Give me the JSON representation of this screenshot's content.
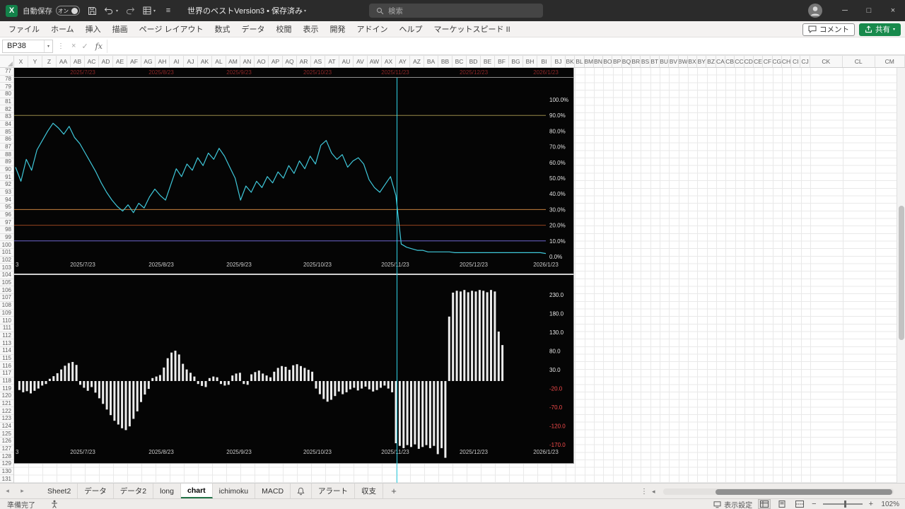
{
  "titlebar": {
    "autosave_label": "自動保存",
    "autosave_state": "オン",
    "document_title": "世界のベストVersion3 • 保存済み",
    "search_placeholder": "検索"
  },
  "menubar": {
    "items": [
      "ファイル",
      "ホーム",
      "挿入",
      "描画",
      "ページ レイアウト",
      "数式",
      "データ",
      "校閲",
      "表示",
      "開発",
      "アドイン",
      "ヘルプ",
      "マーケットスピード II"
    ],
    "comment_label": "コメント",
    "share_label": "共有"
  },
  "formula_bar": {
    "name_box_value": "BP38",
    "fx_label": "fx",
    "cancel_glyph": "×",
    "enter_glyph": "✓",
    "splitter_glyph": "⋮"
  },
  "grid": {
    "columns": [
      "X",
      "Y",
      "Z",
      "AA",
      "AB",
      "AC",
      "AD",
      "AE",
      "AF",
      "AG",
      "AH",
      "AI",
      "AJ",
      "AK",
      "AL",
      "AM",
      "AN",
      "AO",
      "AP",
      "AQ",
      "AR",
      "AS",
      "AT",
      "AU",
      "AV",
      "AW",
      "AX",
      "AY",
      "AZ",
      "BA",
      "BB",
      "BC",
      "BD",
      "BE",
      "BF",
      "BG",
      "BH",
      "BI",
      "BJ",
      "BK",
      "BL",
      "BM",
      "BN",
      "BO",
      "BP",
      "BQ",
      "BR",
      "BS",
      "BT",
      "BU",
      "BV",
      "BW",
      "BX",
      "BY",
      "BZ",
      "CA",
      "CB",
      "CC",
      "CD",
      "CE",
      "CF",
      "CG",
      "CH",
      "CI",
      "CJ",
      "CK",
      "CL",
      "CM"
    ],
    "row_start": 77,
    "row_count": 55
  },
  "chart_data": [
    {
      "type": "line",
      "name": "stochastic-oscillator",
      "line_color": "#3fc8da",
      "y_tick_labels": [
        "100.0%",
        "90.0%",
        "80.0%",
        "70.0%",
        "60.0%",
        "50.0%",
        "40.0%",
        "30.0%",
        "20.0%",
        "10.0%",
        "0.0%"
      ],
      "ref_lines": [
        {
          "value": 90,
          "color": "#968a49"
        },
        {
          "value": 30,
          "color": "#c57f3d"
        },
        {
          "value": 20,
          "color": "#96451f"
        },
        {
          "value": 10,
          "color": "#6f66cf"
        }
      ],
      "x_labels": [
        "2025/7/23",
        "2025/8/23",
        "2025/9/23",
        "2025/10/23",
        "2025/11/23",
        "2025/12/23",
        "2026/1/23"
      ],
      "edge_label": "3",
      "ylim": [
        0,
        110
      ],
      "values": [
        57,
        48,
        62,
        55,
        68,
        74,
        80,
        85,
        82,
        78,
        83,
        76,
        72,
        66,
        60,
        54,
        47,
        41,
        36,
        32,
        29,
        33,
        28,
        34,
        31,
        38,
        43,
        39,
        36,
        46,
        56,
        51,
        59,
        55,
        63,
        58,
        66,
        62,
        69,
        64,
        57,
        50,
        36,
        45,
        41,
        48,
        44,
        51,
        47,
        54,
        50,
        58,
        53,
        61,
        56,
        64,
        59,
        71,
        74,
        66,
        62,
        65,
        57,
        61,
        63,
        59,
        49,
        44,
        41,
        46,
        51,
        39,
        8,
        6,
        5,
        4,
        4,
        3,
        3,
        3,
        3,
        3,
        2.5,
        2.5,
        2.5,
        2.5,
        2.5,
        2.5,
        2.5,
        2.5,
        2.5,
        2.5,
        2.5,
        2.5,
        2.5,
        2.5,
        2.5,
        2.5,
        2.5,
        2
      ]
    },
    {
      "type": "bar",
      "name": "histogram",
      "bar_color": "#ececec",
      "positive_tick_color": "#e8e8e8",
      "negative_tick_color": "#f84c4c",
      "y_tick_labels": [
        "230.0",
        "180.0",
        "130.0",
        "80.0",
        "30.0",
        "-20.0",
        "-70.0",
        "-120.0",
        "-170.0"
      ],
      "x_labels": [
        "2025/7/23",
        "2025/8/23",
        "2025/9/23",
        "2025/10/23",
        "2025/11/23",
        "2025/12/23",
        "2026/1/23"
      ],
      "edge_label": "3",
      "ylim": [
        -225,
        255
      ],
      "values": [
        0,
        -24,
        -30,
        -27,
        -33,
        -26,
        -20,
        -12,
        -8,
        6,
        13,
        21,
        31,
        41,
        48,
        51,
        43,
        -10,
        -18,
        -26,
        -16,
        -31,
        -46,
        -61,
        -76,
        -91,
        -106,
        -116,
        -126,
        -131,
        -121,
        -101,
        -81,
        -56,
        -36,
        -21,
        8,
        12,
        16,
        36,
        61,
        76,
        81,
        71,
        46,
        31,
        22,
        12,
        -8,
        -13,
        -16,
        8,
        12,
        10,
        -8,
        -12,
        -10,
        15,
        20,
        22,
        -8,
        -10,
        18,
        24,
        28,
        20,
        15,
        10,
        25,
        35,
        40,
        38,
        30,
        42,
        45,
        40,
        35,
        30,
        25,
        -20,
        -35,
        -48,
        -55,
        -50,
        -40,
        -28,
        -35,
        -30,
        -22,
        -18,
        -25,
        -20,
        -15,
        -22,
        -28,
        -24,
        -18,
        -12,
        -20,
        -30,
        -166,
        -173,
        -179,
        -171,
        -176,
        -169,
        -181,
        -176,
        -171,
        -179,
        -173,
        -195,
        -179,
        -205,
        172,
        236,
        241,
        239,
        243,
        237,
        241,
        239,
        243,
        241,
        237,
        243,
        239,
        132,
        96,
        0,
        0,
        0,
        0,
        0,
        0,
        0,
        0,
        0,
        0,
        0
      ]
    }
  ],
  "cursor_line": {
    "color": "#2fd4e8"
  },
  "sheet_tabs": {
    "nav_prev": "◂",
    "nav_next": "▸",
    "tabs": [
      "Sheet2",
      "データ",
      "データ2",
      "long",
      "chart",
      "ichimoku",
      "MACD",
      "bell-icon",
      "アラート",
      "収支"
    ],
    "active_tab": "chart",
    "add_button": "+",
    "more_glyph": "⋮",
    "hscroll_left": "◂"
  },
  "status_bar": {
    "ready_label": "準備完了",
    "display_settings_label": "表示設定",
    "zoom_minus": "−",
    "zoom_plus": "+",
    "zoom_percent": "102%"
  }
}
